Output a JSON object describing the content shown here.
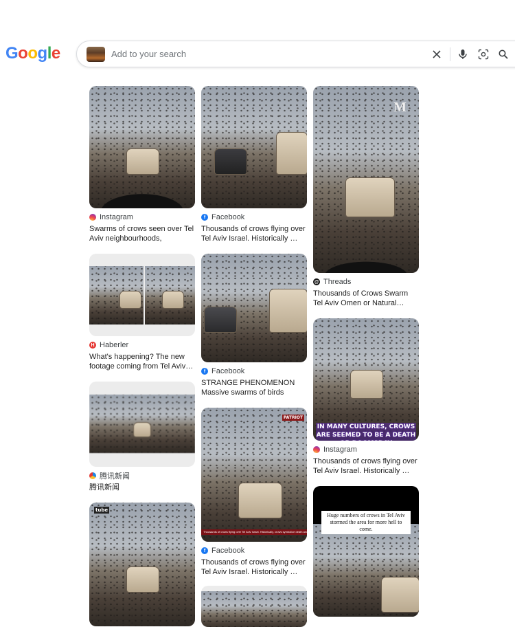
{
  "header": {
    "logo_letters": [
      "G",
      "o",
      "o",
      "g",
      "l",
      "e"
    ],
    "logo_colors": [
      "#4285F4",
      "#EA4335",
      "#FBBC05",
      "#4285F4",
      "#34A853",
      "#EA4335"
    ]
  },
  "search": {
    "placeholder": "Add to your search",
    "value": "",
    "icons": [
      "clear-icon",
      "microphone-icon",
      "camera-lens-icon",
      "search-icon"
    ]
  },
  "results": {
    "col1": [
      {
        "source": "Instagram",
        "source_icon": "instagram-icon",
        "title": "Swarms of crows seen over Tel Aviv neighbourhoods, resident…"
      },
      {
        "source": "Haberler",
        "source_icon": "haberler-icon",
        "title": "What's happening? The new footage coming from Tel Aviv…"
      },
      {
        "source": "腾讯新闻",
        "source_icon": "tencent-news-icon",
        "title": "腾讯新闻"
      },
      {
        "source": "",
        "source_icon": "",
        "title": ""
      }
    ],
    "col2": [
      {
        "source": "Facebook",
        "source_icon": "facebook-icon",
        "title": "Thousands of crows flying over Tel Aviv Israel. Historically …"
      },
      {
        "source": "Facebook",
        "source_icon": "facebook-icon",
        "title": "STRANGE PHENOMENON Massive swarms of birds filme…"
      },
      {
        "source": "Facebook",
        "source_icon": "facebook-icon",
        "title": "Thousands of crows flying over Tel Aviv Israel. Historically …",
        "overlay_brand": "PATRIOT",
        "overlay_caption": "Thousands of crows flying over Tel Aviv Israel. Historically, crows symbolize death and war"
      },
      {
        "source": "",
        "source_icon": "",
        "title": ""
      }
    ],
    "col3": [
      {
        "source": "Threads",
        "source_icon": "threads-icon",
        "title": "Thousands of Crows Swarm Tel Aviv Omen or Natural…",
        "overlay_brand": "M"
      },
      {
        "source": "Instagram",
        "source_icon": "instagram-icon",
        "title": "Thousands of crows flying over Tel Aviv Israel. Historically …",
        "overlay_caption": "IN MANY CULTURES, CROWS ARE SEEMED TO BE A DEATH OR DOOMSDAY"
      },
      {
        "source": "",
        "source_icon": "",
        "title": "",
        "overlay_caption": "Huge numbers of crows in Tel Aviv stormed the area for more hell to come."
      }
    ]
  }
}
